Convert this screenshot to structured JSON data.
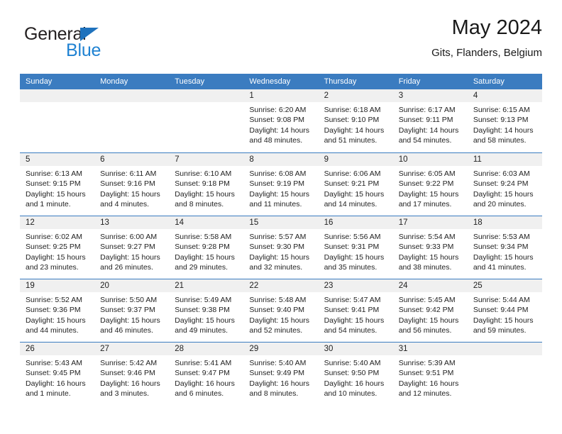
{
  "brand": {
    "name_part1": "General",
    "name_part2": "Blue",
    "triangle_color": "#1f72bd",
    "blue_color": "#1f82d2"
  },
  "header": {
    "title": "May 2024",
    "subtitle": "Gits, Flanders, Belgium"
  },
  "theme": {
    "header_blue": "#3b7cc0",
    "daynum_band": "#f0f0f0",
    "text": "#222222"
  },
  "weekday_headers": [
    "Sunday",
    "Monday",
    "Tuesday",
    "Wednesday",
    "Thursday",
    "Friday",
    "Saturday"
  ],
  "weeks": [
    [
      {
        "day": "",
        "sunrise": "",
        "sunset": "",
        "daylight1": "",
        "daylight2": ""
      },
      {
        "day": "",
        "sunrise": "",
        "sunset": "",
        "daylight1": "",
        "daylight2": ""
      },
      {
        "day": "",
        "sunrise": "",
        "sunset": "",
        "daylight1": "",
        "daylight2": ""
      },
      {
        "day": "1",
        "sunrise": "Sunrise: 6:20 AM",
        "sunset": "Sunset: 9:08 PM",
        "daylight1": "Daylight: 14 hours",
        "daylight2": "and 48 minutes."
      },
      {
        "day": "2",
        "sunrise": "Sunrise: 6:18 AM",
        "sunset": "Sunset: 9:10 PM",
        "daylight1": "Daylight: 14 hours",
        "daylight2": "and 51 minutes."
      },
      {
        "day": "3",
        "sunrise": "Sunrise: 6:17 AM",
        "sunset": "Sunset: 9:11 PM",
        "daylight1": "Daylight: 14 hours",
        "daylight2": "and 54 minutes."
      },
      {
        "day": "4",
        "sunrise": "Sunrise: 6:15 AM",
        "sunset": "Sunset: 9:13 PM",
        "daylight1": "Daylight: 14 hours",
        "daylight2": "and 58 minutes."
      }
    ],
    [
      {
        "day": "5",
        "sunrise": "Sunrise: 6:13 AM",
        "sunset": "Sunset: 9:15 PM",
        "daylight1": "Daylight: 15 hours",
        "daylight2": "and 1 minute."
      },
      {
        "day": "6",
        "sunrise": "Sunrise: 6:11 AM",
        "sunset": "Sunset: 9:16 PM",
        "daylight1": "Daylight: 15 hours",
        "daylight2": "and 4 minutes."
      },
      {
        "day": "7",
        "sunrise": "Sunrise: 6:10 AM",
        "sunset": "Sunset: 9:18 PM",
        "daylight1": "Daylight: 15 hours",
        "daylight2": "and 8 minutes."
      },
      {
        "day": "8",
        "sunrise": "Sunrise: 6:08 AM",
        "sunset": "Sunset: 9:19 PM",
        "daylight1": "Daylight: 15 hours",
        "daylight2": "and 11 minutes."
      },
      {
        "day": "9",
        "sunrise": "Sunrise: 6:06 AM",
        "sunset": "Sunset: 9:21 PM",
        "daylight1": "Daylight: 15 hours",
        "daylight2": "and 14 minutes."
      },
      {
        "day": "10",
        "sunrise": "Sunrise: 6:05 AM",
        "sunset": "Sunset: 9:22 PM",
        "daylight1": "Daylight: 15 hours",
        "daylight2": "and 17 minutes."
      },
      {
        "day": "11",
        "sunrise": "Sunrise: 6:03 AM",
        "sunset": "Sunset: 9:24 PM",
        "daylight1": "Daylight: 15 hours",
        "daylight2": "and 20 minutes."
      }
    ],
    [
      {
        "day": "12",
        "sunrise": "Sunrise: 6:02 AM",
        "sunset": "Sunset: 9:25 PM",
        "daylight1": "Daylight: 15 hours",
        "daylight2": "and 23 minutes."
      },
      {
        "day": "13",
        "sunrise": "Sunrise: 6:00 AM",
        "sunset": "Sunset: 9:27 PM",
        "daylight1": "Daylight: 15 hours",
        "daylight2": "and 26 minutes."
      },
      {
        "day": "14",
        "sunrise": "Sunrise: 5:58 AM",
        "sunset": "Sunset: 9:28 PM",
        "daylight1": "Daylight: 15 hours",
        "daylight2": "and 29 minutes."
      },
      {
        "day": "15",
        "sunrise": "Sunrise: 5:57 AM",
        "sunset": "Sunset: 9:30 PM",
        "daylight1": "Daylight: 15 hours",
        "daylight2": "and 32 minutes."
      },
      {
        "day": "16",
        "sunrise": "Sunrise: 5:56 AM",
        "sunset": "Sunset: 9:31 PM",
        "daylight1": "Daylight: 15 hours",
        "daylight2": "and 35 minutes."
      },
      {
        "day": "17",
        "sunrise": "Sunrise: 5:54 AM",
        "sunset": "Sunset: 9:33 PM",
        "daylight1": "Daylight: 15 hours",
        "daylight2": "and 38 minutes."
      },
      {
        "day": "18",
        "sunrise": "Sunrise: 5:53 AM",
        "sunset": "Sunset: 9:34 PM",
        "daylight1": "Daylight: 15 hours",
        "daylight2": "and 41 minutes."
      }
    ],
    [
      {
        "day": "19",
        "sunrise": "Sunrise: 5:52 AM",
        "sunset": "Sunset: 9:36 PM",
        "daylight1": "Daylight: 15 hours",
        "daylight2": "and 44 minutes."
      },
      {
        "day": "20",
        "sunrise": "Sunrise: 5:50 AM",
        "sunset": "Sunset: 9:37 PM",
        "daylight1": "Daylight: 15 hours",
        "daylight2": "and 46 minutes."
      },
      {
        "day": "21",
        "sunrise": "Sunrise: 5:49 AM",
        "sunset": "Sunset: 9:38 PM",
        "daylight1": "Daylight: 15 hours",
        "daylight2": "and 49 minutes."
      },
      {
        "day": "22",
        "sunrise": "Sunrise: 5:48 AM",
        "sunset": "Sunset: 9:40 PM",
        "daylight1": "Daylight: 15 hours",
        "daylight2": "and 52 minutes."
      },
      {
        "day": "23",
        "sunrise": "Sunrise: 5:47 AM",
        "sunset": "Sunset: 9:41 PM",
        "daylight1": "Daylight: 15 hours",
        "daylight2": "and 54 minutes."
      },
      {
        "day": "24",
        "sunrise": "Sunrise: 5:45 AM",
        "sunset": "Sunset: 9:42 PM",
        "daylight1": "Daylight: 15 hours",
        "daylight2": "and 56 minutes."
      },
      {
        "day": "25",
        "sunrise": "Sunrise: 5:44 AM",
        "sunset": "Sunset: 9:44 PM",
        "daylight1": "Daylight: 15 hours",
        "daylight2": "and 59 minutes."
      }
    ],
    [
      {
        "day": "26",
        "sunrise": "Sunrise: 5:43 AM",
        "sunset": "Sunset: 9:45 PM",
        "daylight1": "Daylight: 16 hours",
        "daylight2": "and 1 minute."
      },
      {
        "day": "27",
        "sunrise": "Sunrise: 5:42 AM",
        "sunset": "Sunset: 9:46 PM",
        "daylight1": "Daylight: 16 hours",
        "daylight2": "and 3 minutes."
      },
      {
        "day": "28",
        "sunrise": "Sunrise: 5:41 AM",
        "sunset": "Sunset: 9:47 PM",
        "daylight1": "Daylight: 16 hours",
        "daylight2": "and 6 minutes."
      },
      {
        "day": "29",
        "sunrise": "Sunrise: 5:40 AM",
        "sunset": "Sunset: 9:49 PM",
        "daylight1": "Daylight: 16 hours",
        "daylight2": "and 8 minutes."
      },
      {
        "day": "30",
        "sunrise": "Sunrise: 5:40 AM",
        "sunset": "Sunset: 9:50 PM",
        "daylight1": "Daylight: 16 hours",
        "daylight2": "and 10 minutes."
      },
      {
        "day": "31",
        "sunrise": "Sunrise: 5:39 AM",
        "sunset": "Sunset: 9:51 PM",
        "daylight1": "Daylight: 16 hours",
        "daylight2": "and 12 minutes."
      },
      {
        "day": "",
        "sunrise": "",
        "sunset": "",
        "daylight1": "",
        "daylight2": ""
      }
    ]
  ]
}
